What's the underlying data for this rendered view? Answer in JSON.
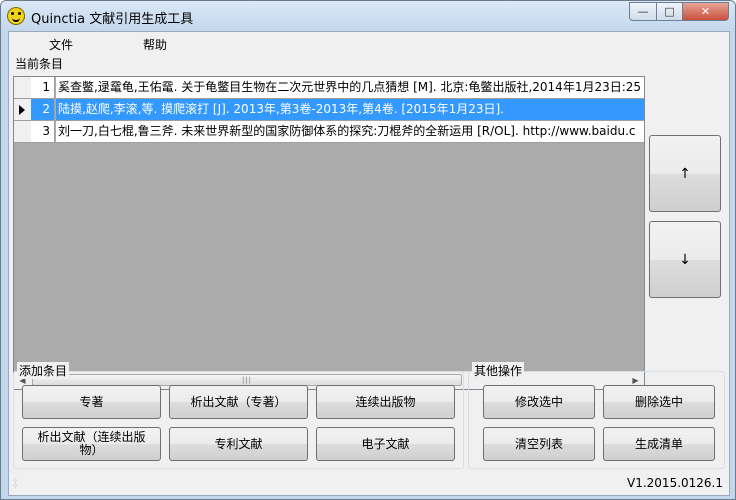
{
  "window": {
    "title": "Quinctia 文献引用生成工具"
  },
  "titlebar_buttons": {
    "minimize": "—",
    "maximize": "□",
    "close": "✕"
  },
  "menu": {
    "file": "文件",
    "help": "帮助"
  },
  "list_section": {
    "label": "当前条目",
    "rows": [
      {
        "num": "1",
        "text": "奚查鳖,逯鼋龟,王佑鼋. 关于龟鳖目生物在二次元世界中的几点猜想 [M]. 北京:龟鳖出版社,2014年1月23日:25",
        "selected": false
      },
      {
        "num": "2",
        "text": "陆摸,赵爬,李滚,等. 摸爬滚打 [J]. 2013年,第3卷-2013年,第4卷. [2015年1月23日].",
        "selected": true
      },
      {
        "num": "3",
        "text": "刘一刀,白七棍,鲁三斧. 未来世界新型的国家防御体系的探究:刀棍斧的全新运用 [R/OL]. http://www.baidu.c",
        "selected": false
      }
    ],
    "scroll_left": "◀",
    "scroll_right": "▶",
    "scroll_grip": "|||"
  },
  "side_buttons": {
    "up": "↑",
    "down": "↓"
  },
  "add_section": {
    "label": "添加条目",
    "buttons": {
      "monograph": "专著",
      "analytic_monograph": "析出文献（专著）",
      "serial": "连续出版物",
      "analytic_serial": "析出文献（连续出版物）",
      "patent": "专利文献",
      "electronic": "电子文献"
    }
  },
  "other_section": {
    "label": "其他操作",
    "buttons": {
      "edit": "修改选中",
      "delete": "删除选中",
      "clear": "清空列表",
      "generate": "生成清单"
    }
  },
  "status": {
    "version": "V1.2015.0126.1"
  }
}
